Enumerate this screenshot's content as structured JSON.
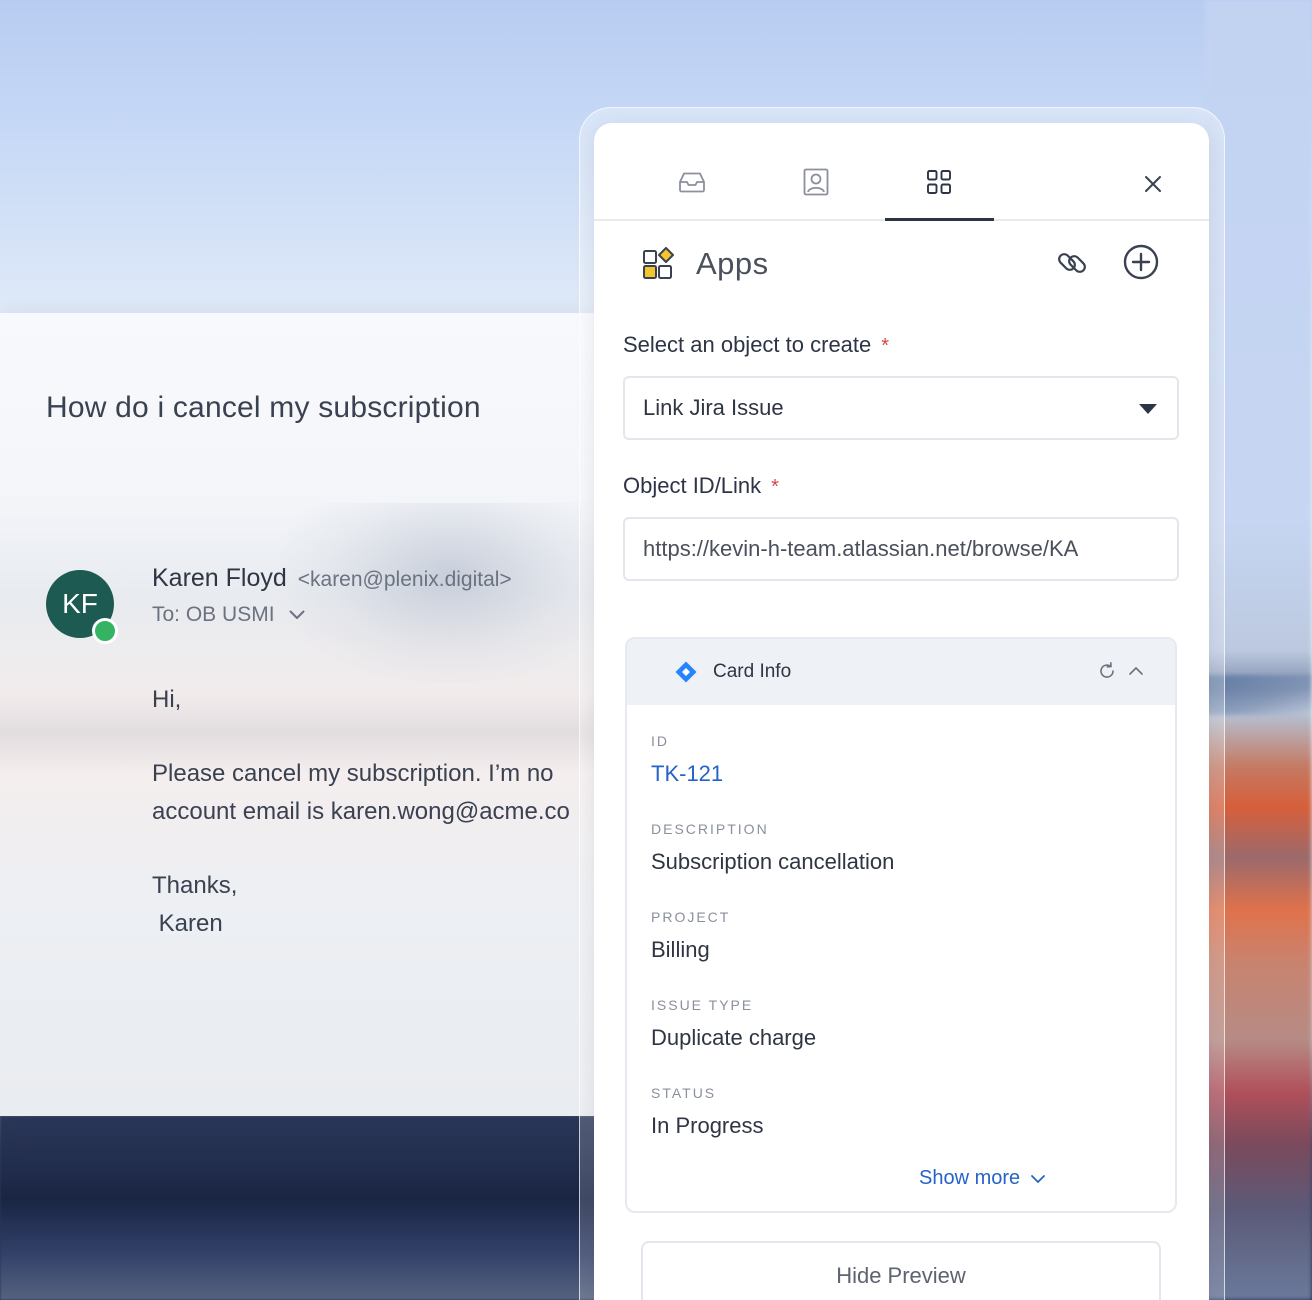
{
  "email": {
    "subject": "How do i cancel my subscription",
    "avatar_initials": "KF",
    "sender_name": "Karen Floyd",
    "sender_email": "<karen@plenix.digital>",
    "recipient": "To: OB USMI",
    "greeting": "Hi,",
    "body_line1": "Please cancel my subscription. I’m no",
    "body_line2": "account email is karen.wong@acme.co",
    "sign_off": "Thanks,",
    "signature": " Karen"
  },
  "side_panel": {
    "tabs": [
      {
        "icon": "inbox-icon"
      },
      {
        "icon": "contact-icon"
      },
      {
        "icon": "apps-grid-icon",
        "active": true
      }
    ],
    "apps_title": "Apps",
    "object_label": "Select an object to create",
    "object_required": "*",
    "object_value": "Link Jira Issue",
    "id_label": "Object ID/Link",
    "id_required": "*",
    "id_value": "https://kevin-h-team.atlassian.net/browse/KA",
    "card": {
      "title": "Card Info",
      "fields": [
        {
          "key": "ID",
          "value": "TK-121"
        },
        {
          "key": "DESCRIPTION",
          "value": "Subscription cancellation"
        },
        {
          "key": "PROJECT",
          "value": "Billing"
        },
        {
          "key": "ISSUE TYPE",
          "value": "Duplicate charge"
        },
        {
          "key": "STATUS",
          "value": "In Progress"
        }
      ],
      "show_more": "Show more"
    },
    "hide_preview": "Hide Preview"
  },
  "colors": {
    "accent_link": "#2563c9",
    "avatar_bg": "#1d5b52",
    "online": "#34b463",
    "required": "#d04848",
    "jira": "#2684ff"
  }
}
